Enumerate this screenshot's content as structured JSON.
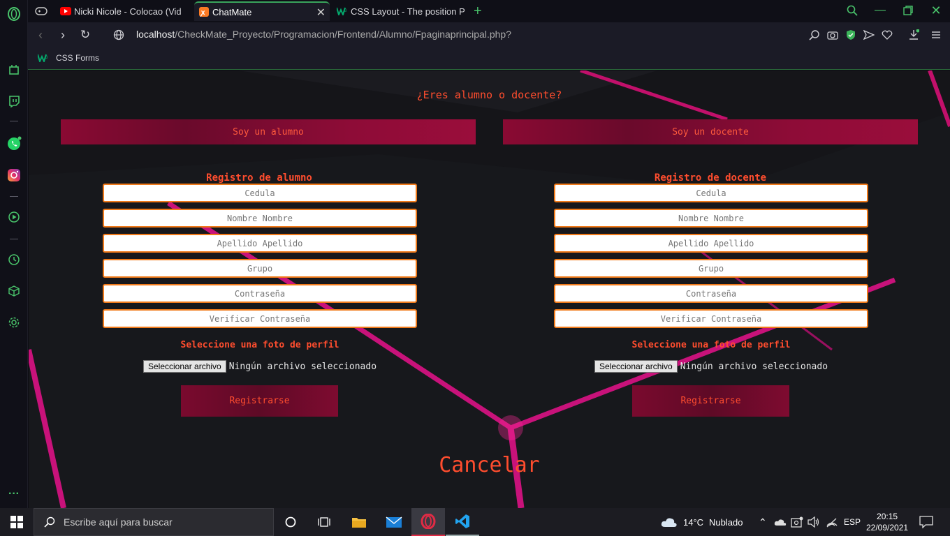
{
  "browser": {
    "tabs": [
      {
        "title": "Nicki Nicole - Colocao (Vid",
        "active": false
      },
      {
        "title": "ChatMate",
        "active": true
      },
      {
        "title": "CSS Layout - The position P",
        "active": false
      }
    ],
    "url_host": "localhost",
    "url_path": "/CheckMate_Proyecto/Programacion/Frontend/Alumno/Fpaginaprincipal.php?",
    "bookmarks": [
      {
        "label": "CSS Forms"
      }
    ]
  },
  "page": {
    "question": "¿Eres alumno o docente?",
    "student_button": "Soy un alumno",
    "teacher_button": "Soy un docente",
    "student_form": {
      "title": "Registro de alumno",
      "placeholders": [
        "Cedula",
        "Nombre Nombre",
        "Apellido Apellido",
        "Grupo",
        "Contraseña",
        "Verificar Contraseña"
      ],
      "photo_label": "Seleccione una foto de perfil",
      "file_button": "Seleccionar archivo",
      "file_status": "Ningún archivo seleccionado",
      "submit": "Registrarse"
    },
    "teacher_form": {
      "title": "Registro de docente",
      "placeholders": [
        "Cedula",
        "Nombre Nombre",
        "Apellido Apellido",
        "Grupo",
        "Contraseña",
        "Verificar Contraseña"
      ],
      "photo_label": "Seleccione una foto de perfil",
      "file_button": "Seleccionar archivo",
      "file_status": "Ningún archivo seleccionado",
      "submit": "Registrarse"
    },
    "cancel": "Cancelar"
  },
  "taskbar": {
    "search_placeholder": "Escribe aquí para buscar",
    "weather_temp": "14°C",
    "weather_desc": "Nublado",
    "language": "ESP",
    "time": "20:15",
    "date": "22/09/2021"
  },
  "colors": {
    "accent": "#ff4d2e",
    "button": "#8a0a33",
    "border": "#f07a1a",
    "opera_green": "#49c46b"
  }
}
